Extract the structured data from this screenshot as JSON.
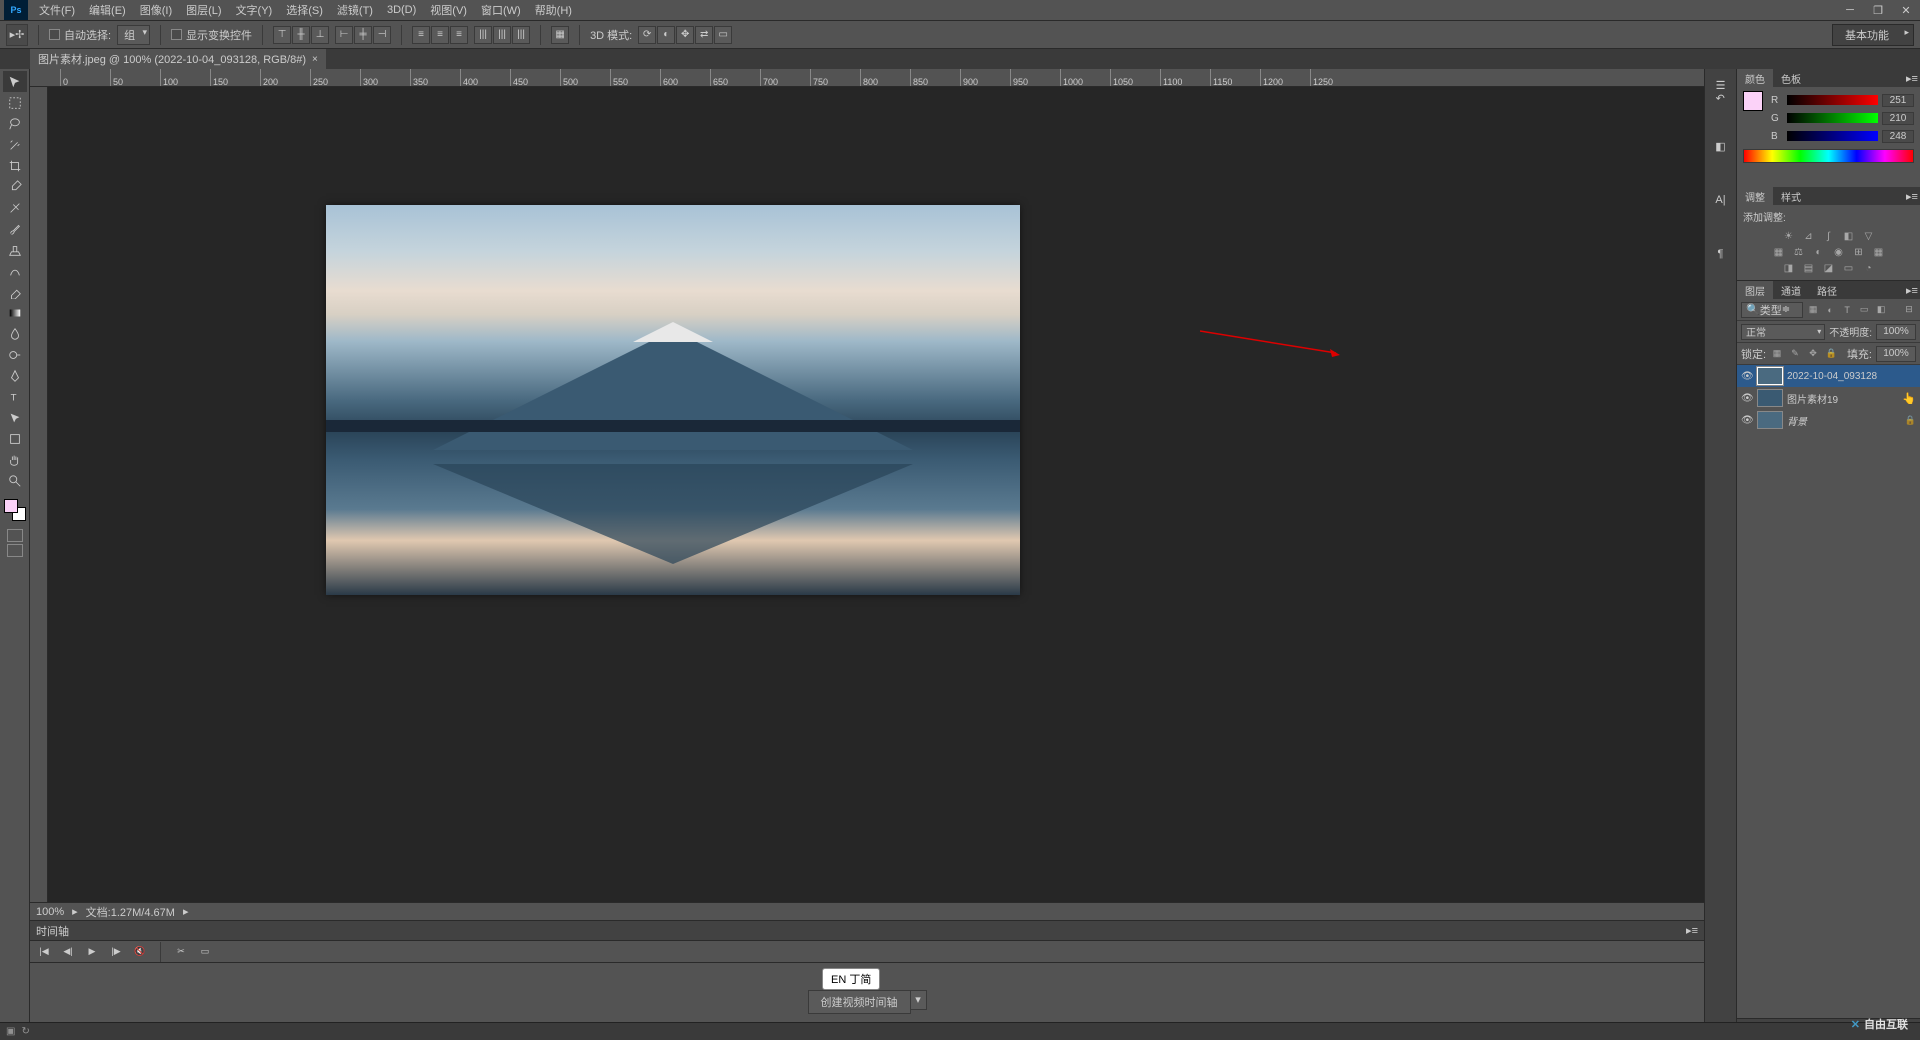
{
  "menu": [
    "文件(F)",
    "编辑(E)",
    "图像(I)",
    "图层(L)",
    "文字(Y)",
    "选择(S)",
    "滤镜(T)",
    "3D(D)",
    "视图(V)",
    "窗口(W)",
    "帮助(H)"
  ],
  "options": {
    "auto_select": "自动选择:",
    "group": "组",
    "show_transform": "显示变换控件",
    "mode_3d": "3D 模式:"
  },
  "workspace": "基本功能",
  "tab": {
    "title": "图片素材.jpeg @ 100% (2022-10-04_093128, RGB/8#)"
  },
  "ruler": [
    "0",
    "50",
    "100",
    "150",
    "200",
    "250",
    "300",
    "350",
    "400",
    "450",
    "500",
    "550",
    "600",
    "650",
    "700",
    "750",
    "800",
    "850",
    "900",
    "950",
    "1000",
    "1050",
    "1100",
    "1150",
    "1200",
    "1250"
  ],
  "status": {
    "zoom": "100%",
    "doc": "文档:1.27M/4.67M"
  },
  "timeline": {
    "title": "时间轴",
    "create": "创建视频时间轴"
  },
  "color_panel": {
    "tab_color": "颜色",
    "tab_swatch": "色板",
    "r": "R",
    "g": "G",
    "b": "B",
    "r_val": "251",
    "g_val": "210",
    "b_val": "248"
  },
  "adj_panel": {
    "tab_adj": "调整",
    "tab_style": "样式",
    "title": "添加调整:"
  },
  "layers_panel": {
    "tab_layers": "图层",
    "tab_channels": "通道",
    "tab_paths": "路径",
    "filter": "类型",
    "blend": "正常",
    "opacity_label": "不透明度:",
    "opacity_val": "100%",
    "lock_label": "锁定:",
    "fill_label": "填充:",
    "fill_val": "100%",
    "layers": [
      {
        "name": "2022-10-04_093128",
        "selected": true
      },
      {
        "name": "图片素材19"
      },
      {
        "name": "背景",
        "italic": true,
        "locked": true
      }
    ]
  },
  "ime": "EN 丁简",
  "watermark": "自由互联"
}
